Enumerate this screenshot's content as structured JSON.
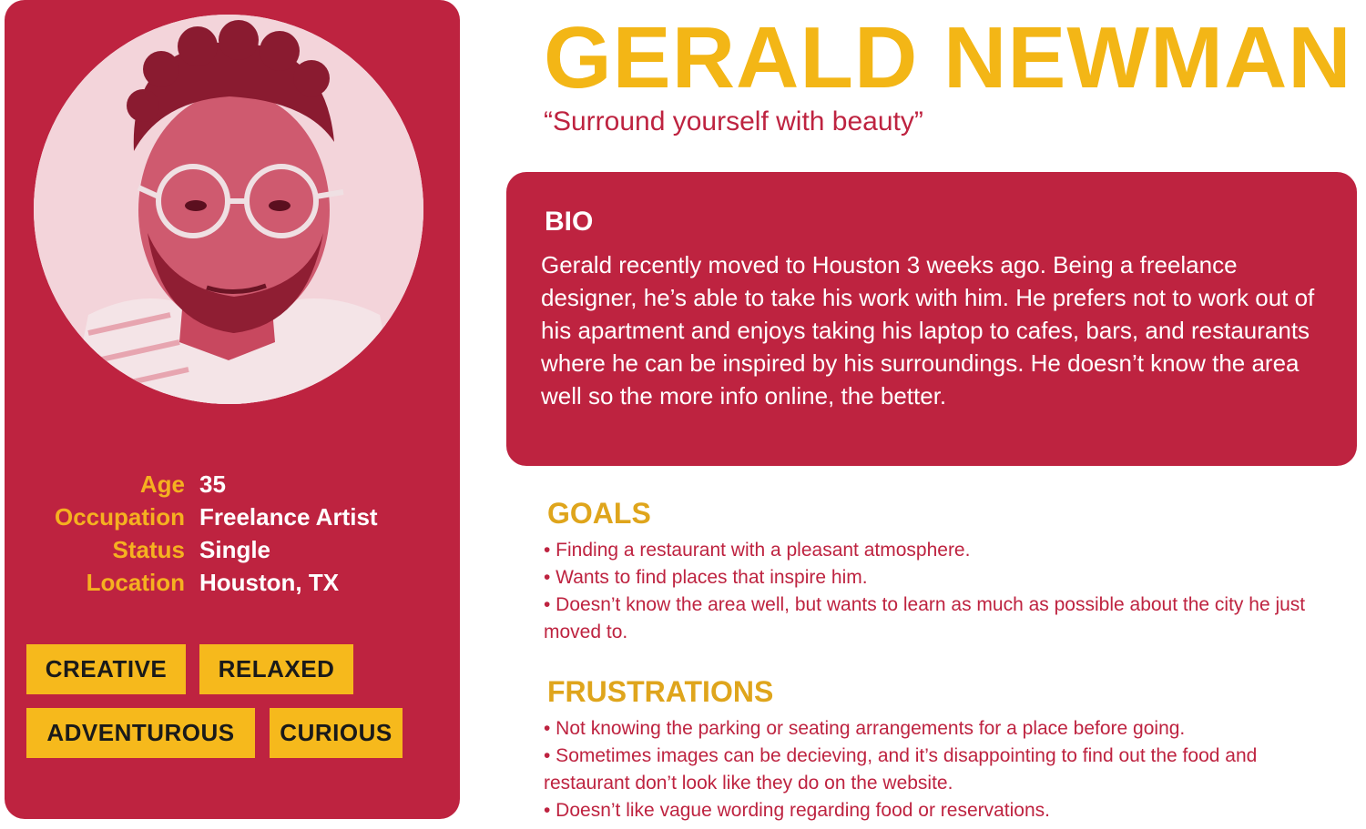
{
  "persona": {
    "name": "GERALD NEWMAN",
    "quote": "“Surround yourself with beauty”",
    "details": [
      {
        "key": "Age",
        "value": "35"
      },
      {
        "key": "Occupation",
        "value": "Freelance Artist"
      },
      {
        "key": "Status",
        "value": "Single"
      },
      {
        "key": "Location",
        "value": "Houston, TX"
      }
    ],
    "traits": [
      "CREATIVE",
      "RELAXED",
      "ADVENTUROUS",
      "CURIOUS"
    ]
  },
  "bio": {
    "title": "BIO",
    "text": "Gerald recently moved to Houston 3 weeks ago. Being a freelance designer, he’s able to take his work with him. He prefers not to work out of his apartment and enjoys taking his laptop to cafes, bars, and restaurants where he can be inspired by his surroundings. He doesn’t know the area well so the more info online, the better."
  },
  "goals": {
    "title": "GOALS",
    "items": [
      "• Finding a restaurant with a pleasant atmosphere.",
      "• Wants to find places that inspire him.",
      "• Doesn’t know the area well, but wants to learn as much as possible about the city he just moved to."
    ]
  },
  "frustrations": {
    "title": "FRUSTRATIONS",
    "items": [
      "• Not knowing the parking or seating arrangements for a place before going.",
      "• Sometimes images can be decieving, and it’s disappointing to find out the food and restaurant don’t look like they do on the website.",
      "• Doesn’t like vague wording regarding food or reservations."
    ]
  },
  "colors": {
    "primary": "#be2340",
    "accent": "#f3b616",
    "tag_bg": "#f6b91c",
    "section_title": "#dfa51c"
  },
  "icons": {
    "avatar": "persona-photo"
  }
}
